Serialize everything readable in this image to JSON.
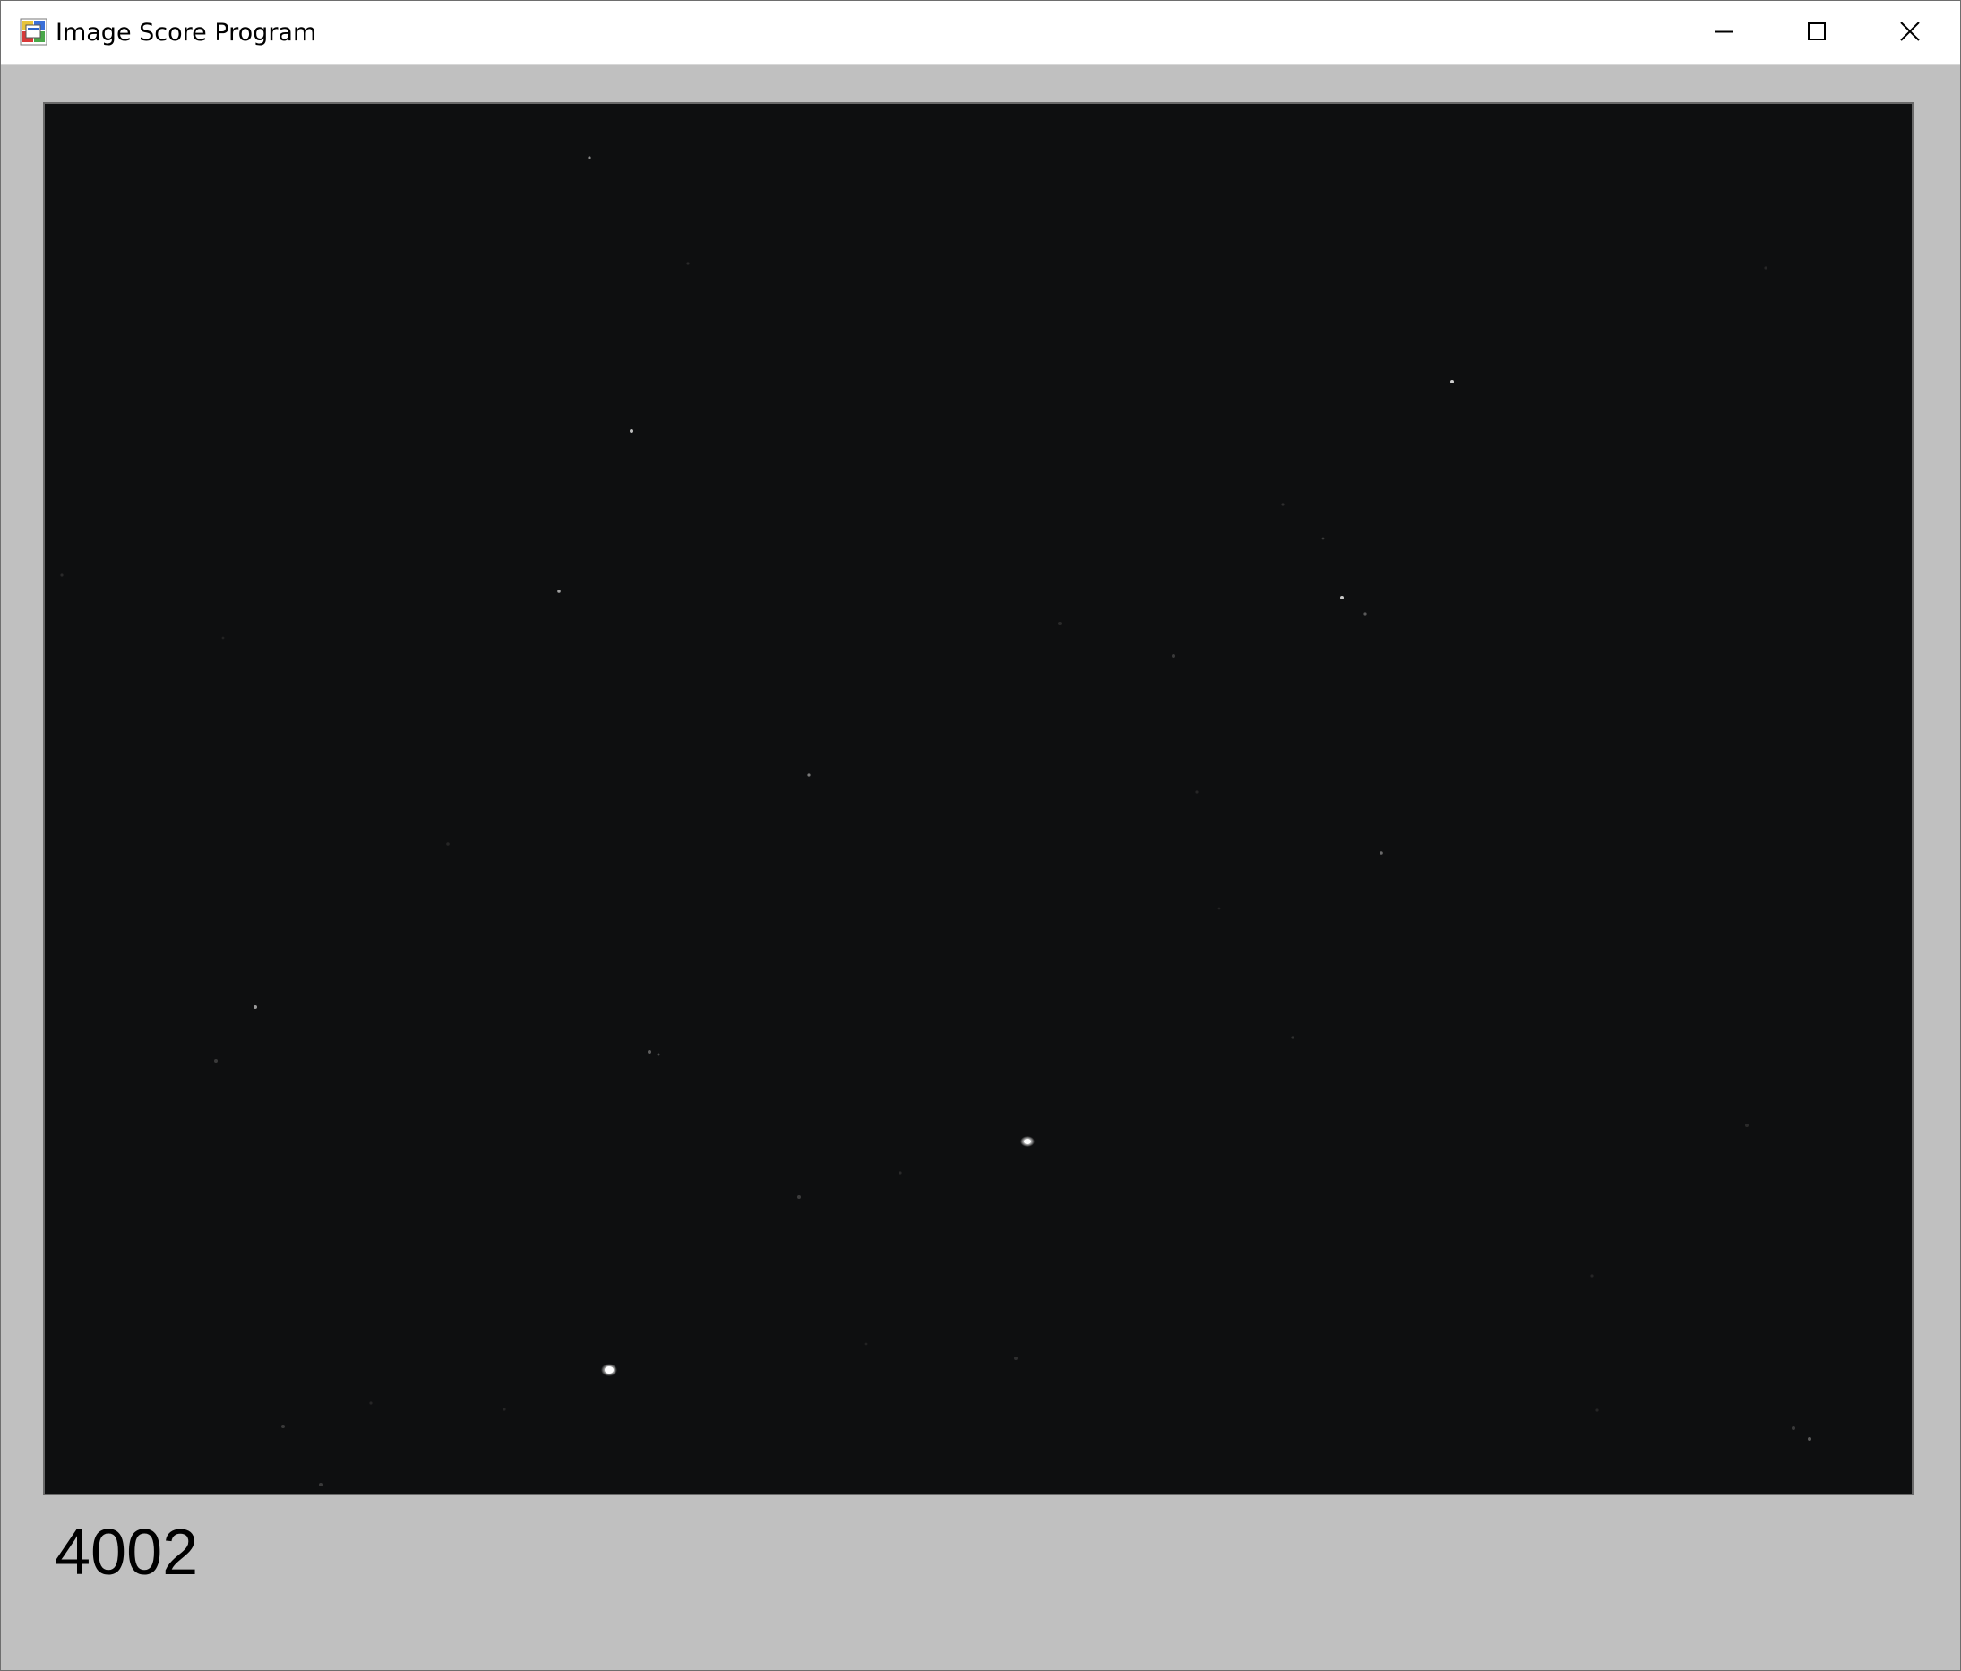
{
  "window": {
    "title": "Image Score Program",
    "icon": "app-window-icon"
  },
  "caption_buttons": {
    "minimize_icon": "minimize-icon",
    "maximize_icon": "maximize-icon",
    "close_icon": "close-icon"
  },
  "image_view": {
    "background_color": "#0e0f10"
  },
  "score": {
    "value": "4002"
  }
}
